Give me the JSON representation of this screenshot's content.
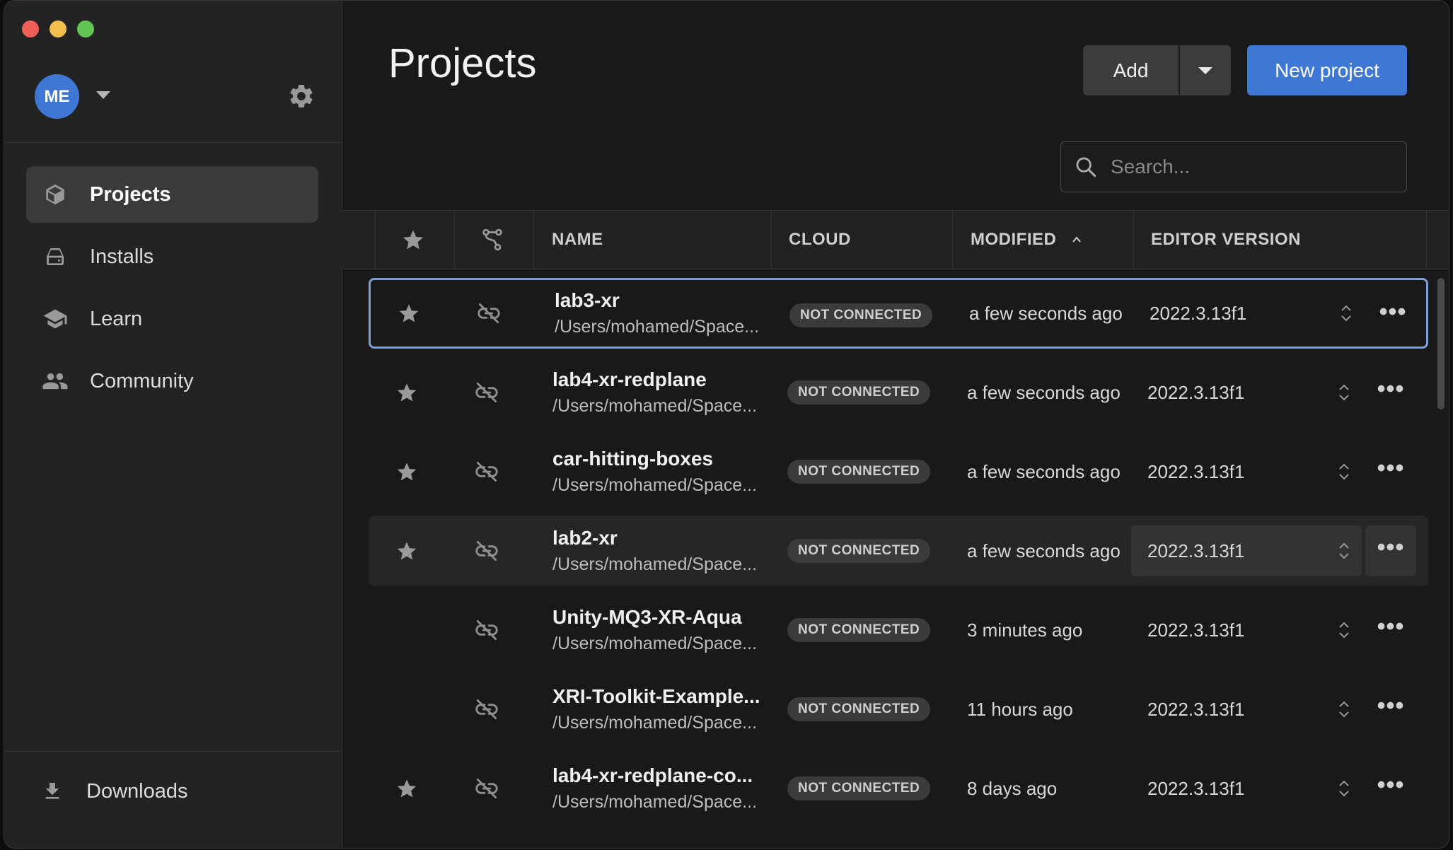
{
  "window": {
    "traffic_lights": [
      "close",
      "minimize",
      "zoom"
    ]
  },
  "sidebar": {
    "avatar_initials": "ME",
    "items": [
      {
        "label": "Projects",
        "icon": "cube-icon",
        "active": true
      },
      {
        "label": "Installs",
        "icon": "drive-icon",
        "active": false
      },
      {
        "label": "Learn",
        "icon": "graduation-cap-icon",
        "active": false
      },
      {
        "label": "Community",
        "icon": "people-icon",
        "active": false
      }
    ],
    "downloads_label": "Downloads"
  },
  "header": {
    "title": "Projects",
    "add_label": "Add",
    "new_project_label": "New project",
    "search_placeholder": "Search..."
  },
  "table": {
    "columns": {
      "name": "NAME",
      "cloud": "CLOUD",
      "modified": "MODIFIED",
      "editor_version": "EDITOR VERSION"
    },
    "sort": {
      "column": "modified",
      "direction": "ascending"
    },
    "rows": [
      {
        "name": "lab3-xr",
        "path": "/Users/mohamed/Space...",
        "cloud": "NOT CONNECTED",
        "modified": "a few seconds ago",
        "version": "2022.3.13f1",
        "starred": true
      },
      {
        "name": "lab4-xr-redplane",
        "path": "/Users/mohamed/Space...",
        "cloud": "NOT CONNECTED",
        "modified": "a few seconds ago",
        "version": "2022.3.13f1",
        "starred": true
      },
      {
        "name": "car-hitting-boxes",
        "path": "/Users/mohamed/Space...",
        "cloud": "NOT CONNECTED",
        "modified": "a few seconds ago",
        "version": "2022.3.13f1",
        "starred": true
      },
      {
        "name": "lab2-xr",
        "path": "/Users/mohamed/Space...",
        "cloud": "NOT CONNECTED",
        "modified": "a few seconds ago",
        "version": "2022.3.13f1",
        "starred": true
      },
      {
        "name": "Unity-MQ3-XR-Aqua",
        "path": "/Users/mohamed/Space...",
        "cloud": "NOT CONNECTED",
        "modified": "3 minutes ago",
        "version": "2022.3.13f1",
        "starred": false
      },
      {
        "name": "XRI-Toolkit-Example...",
        "path": "/Users/mohamed/Space...",
        "cloud": "NOT CONNECTED",
        "modified": "11 hours ago",
        "version": "2022.3.13f1",
        "starred": false
      },
      {
        "name": "lab4-xr-redplane-co...",
        "path": "/Users/mohamed/Space...",
        "cloud": "NOT CONNECTED",
        "modified": "8 days ago",
        "version": "2022.3.13f1",
        "starred": true
      }
    ]
  },
  "colors": {
    "accent": "#3f78d4",
    "selection_border": "#7d9fd6",
    "background": "#191919",
    "sidebar": "#232323"
  }
}
